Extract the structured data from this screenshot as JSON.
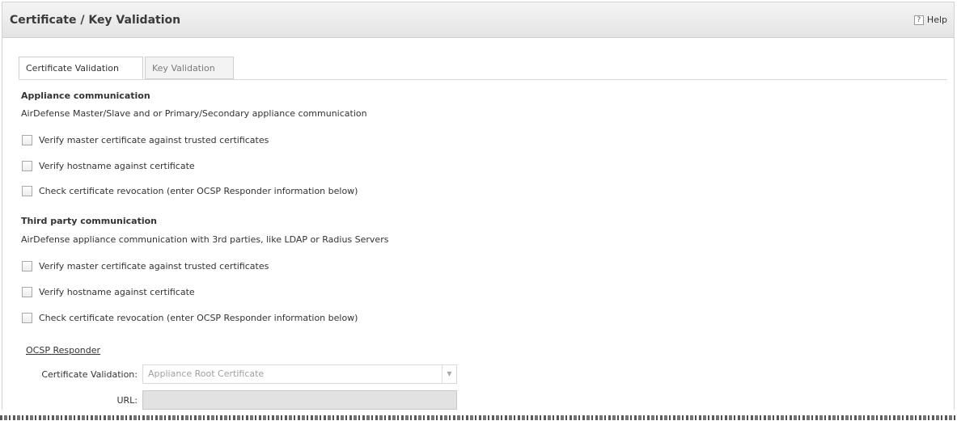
{
  "header": {
    "title": "Certificate / Key Validation",
    "help_label": "Help",
    "help_icon_glyph": "?"
  },
  "tabs": [
    {
      "label": "Certificate Validation",
      "active": true
    },
    {
      "label": "Key Validation",
      "active": false
    }
  ],
  "appliance": {
    "title": "Appliance communication",
    "description": "AirDefense Master/Slave and or Primary/Secondary appliance communication",
    "options": [
      {
        "label": "Verify master certificate against trusted certificates",
        "checked": false
      },
      {
        "label": "Verify hostname against certificate",
        "checked": false
      },
      {
        "label": "Check certificate revocation (enter OCSP Responder information below)",
        "checked": false
      }
    ]
  },
  "third_party": {
    "title": "Third party communication",
    "description": "AirDefense appliance communication with 3rd parties, like LDAP or Radius Servers",
    "options": [
      {
        "label": "Verify master certificate against trusted certificates",
        "checked": false
      },
      {
        "label": "Verify hostname against certificate",
        "checked": false
      },
      {
        "label": "Check certificate revocation (enter OCSP Responder information below)",
        "checked": false
      }
    ]
  },
  "ocsp": {
    "link_label": "OCSP Responder",
    "cert_validation_label": "Certificate Validation:",
    "cert_validation_value": "Appliance Root Certificate",
    "url_label": "URL:",
    "url_value": ""
  },
  "icons": {
    "help": "help-icon",
    "dropdown": "chevron-down-icon"
  }
}
